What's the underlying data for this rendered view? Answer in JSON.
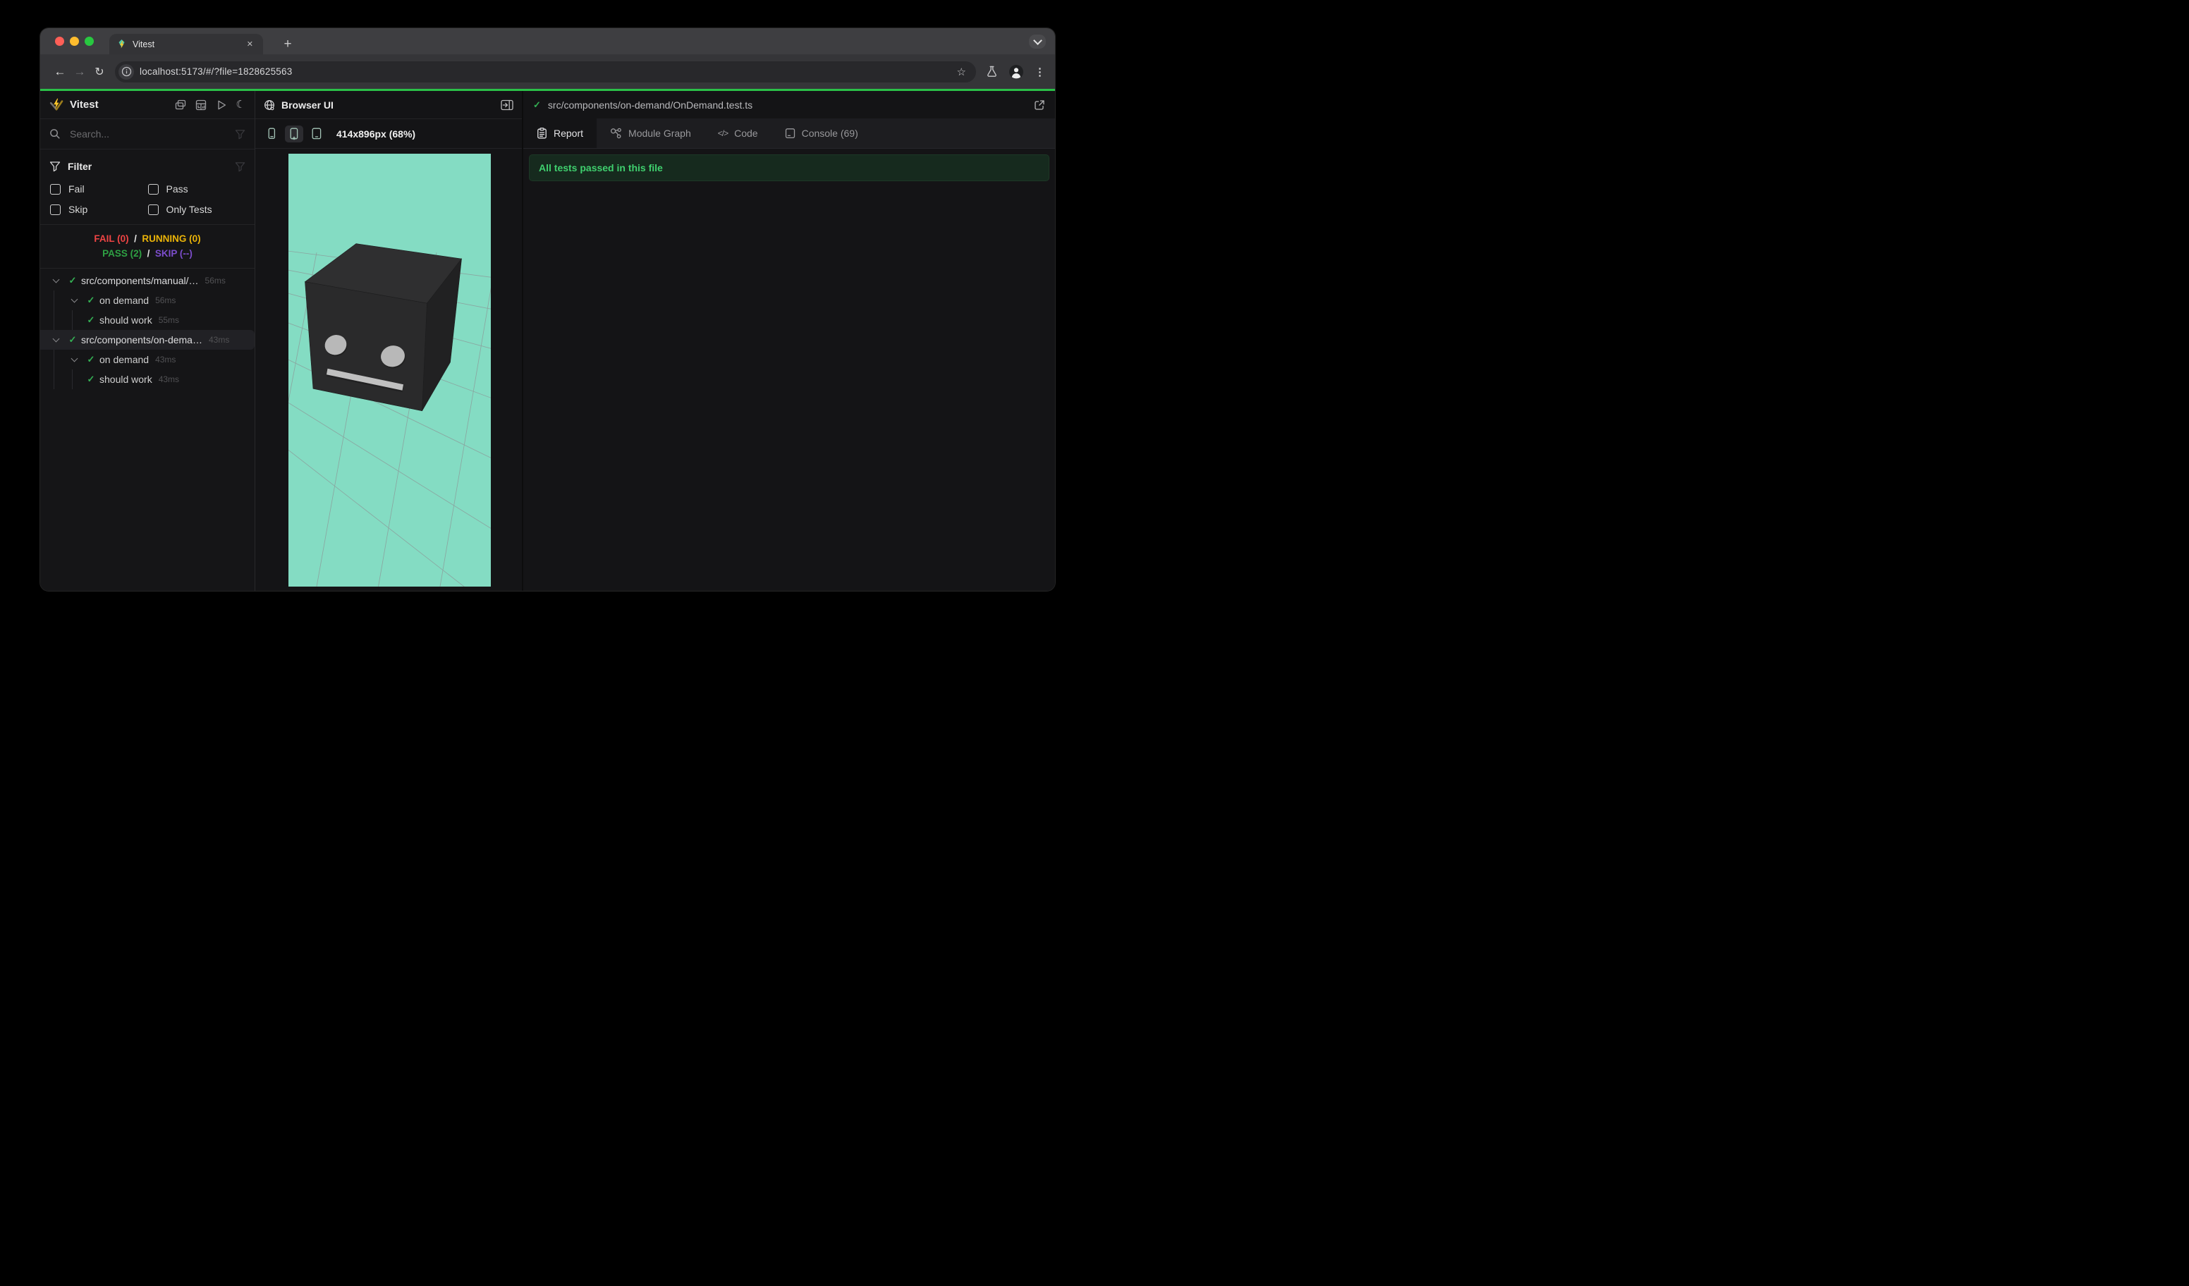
{
  "browser": {
    "tab_title": "Vitest",
    "url": "localhost:5173/#/?file=1828625563",
    "icons": {
      "back": "←",
      "forward": "→",
      "reload": "↻",
      "star": "☆",
      "kebab": "⋮",
      "close": "✕",
      "new_tab": "+"
    },
    "traffic_lights": {
      "close": "#ff5f57",
      "minimize": "#febc2e",
      "zoom": "#28c840"
    }
  },
  "icons": {
    "moon": "☾",
    "check": "✓"
  },
  "sidebar": {
    "app_title": "Vitest",
    "search_placeholder": "Search...",
    "filter": {
      "title": "Filter",
      "options": [
        {
          "label": "Fail",
          "checked": false
        },
        {
          "label": "Pass",
          "checked": false
        },
        {
          "label": "Skip",
          "checked": false
        },
        {
          "label": "Only Tests",
          "checked": false
        }
      ]
    },
    "summary": {
      "fail": "FAIL (0)",
      "running": "RUNNING (0)",
      "pass": "PASS (2)",
      "skip": "SKIP (--)",
      "separator": "/"
    },
    "tree": [
      {
        "label": "src/components/manual/…",
        "time": "56ms",
        "level": 0,
        "type": "file",
        "status": "pass",
        "selected": false
      },
      {
        "label": "on demand",
        "time": "56ms",
        "level": 1,
        "type": "suite",
        "status": "pass"
      },
      {
        "label": "should work",
        "time": "55ms",
        "level": 2,
        "type": "test",
        "status": "pass"
      },
      {
        "label": "src/components/on-dema…",
        "time": "43ms",
        "level": 0,
        "type": "file",
        "status": "pass",
        "selected": true
      },
      {
        "label": "on demand",
        "time": "43ms",
        "level": 1,
        "type": "suite",
        "status": "pass"
      },
      {
        "label": "should work",
        "time": "43ms",
        "level": 2,
        "type": "test",
        "status": "pass"
      }
    ]
  },
  "browser_panel": {
    "title": "Browser UI",
    "viewport_label": "414x896px (68%)",
    "selected_device": "phone-plus"
  },
  "report_panel": {
    "file_path": "src/components/on-demand/OnDemand.test.ts",
    "tabs": [
      {
        "label": "Report",
        "active": true
      },
      {
        "label": "Module Graph",
        "active": false
      },
      {
        "label": "Code",
        "active": false
      },
      {
        "label": "Console (69)",
        "active": false
      }
    ],
    "banner": "All tests passed in this file"
  },
  "colors": {
    "accent_green_line": "#2bc048",
    "viewport_teal": "#84dcc3",
    "fail": "#ef4444",
    "running": "#eab308",
    "pass": "#2ea043",
    "skip": "#7c4dcc",
    "check": "#34b054",
    "banner_text": "#3fcf6e",
    "banner_bg": "#162a1e"
  }
}
